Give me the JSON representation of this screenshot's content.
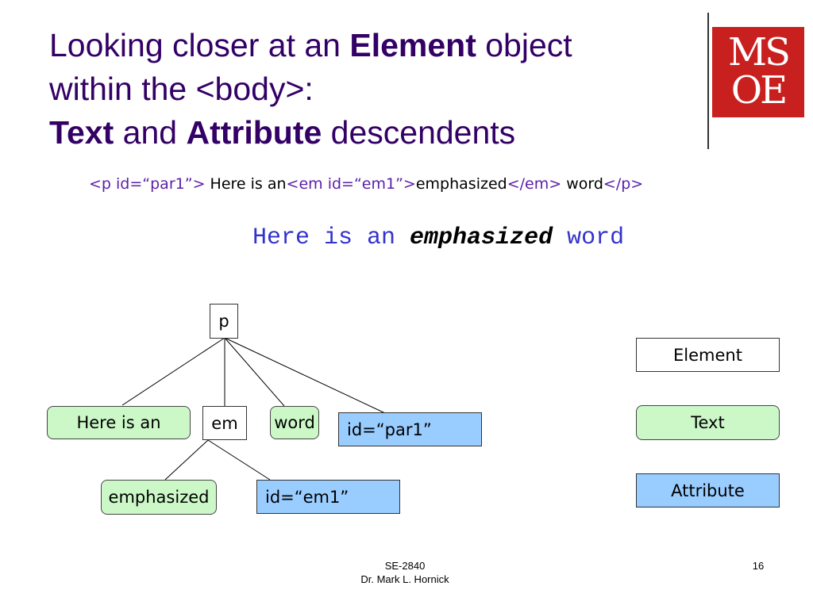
{
  "slide": {
    "title": {
      "line1_pre": "Looking closer at an ",
      "line1_bold": "Element",
      "line1_post": " object",
      "line2": "within the <body>:",
      "line3_bold1": "Text",
      "line3_mid": " and ",
      "line3_bold2": "Attribute",
      "line3_post": " descendents"
    },
    "logo": {
      "line1": "MS",
      "line2": "OE"
    },
    "code_line": {
      "open_p": "<p id=“par1”>",
      "text1": " Here is an",
      "open_em": "<em id=“em1”>",
      "em_text": "emphasized",
      "close_em": "</em>",
      "text2": " word",
      "close_p": "</p>"
    },
    "rendered": {
      "before": "Here is an ",
      "emphasized": "emphasized",
      "after": " word"
    },
    "tree": {
      "root": "p",
      "children": [
        {
          "label": "Here is an",
          "kind": "text"
        },
        {
          "label": "em",
          "kind": "element"
        },
        {
          "label": "word",
          "kind": "text"
        },
        {
          "label": "id=“par1”",
          "kind": "attribute"
        }
      ],
      "em_children": [
        {
          "label": "emphasized",
          "kind": "text"
        },
        {
          "label": "id=“em1”",
          "kind": "attribute"
        }
      ]
    },
    "legend": {
      "element": "Element",
      "text": "Text",
      "attribute": "Attribute"
    },
    "colors": {
      "title": "#330066",
      "text_node": "#ccf8c8",
      "attribute_node": "#99ccff",
      "logo": "#c8201e"
    },
    "footer": {
      "course": "SE-2840",
      "author": "Dr. Mark L. Hornick",
      "page": "16"
    }
  }
}
